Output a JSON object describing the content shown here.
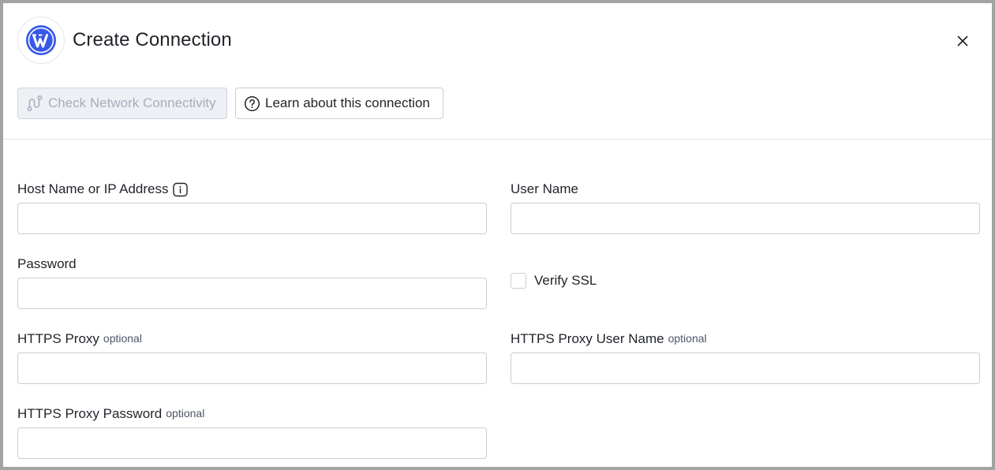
{
  "dialog": {
    "title": "Create Connection",
    "logo_icon": "wordpress-icon",
    "close_icon": "close-icon"
  },
  "toolbar": {
    "check_network_label": "Check Network Connectivity",
    "check_network_icon": "network-route-icon",
    "learn_label": "Learn about this connection",
    "learn_icon": "help-circle-icon"
  },
  "form": {
    "host": {
      "label": "Host Name or IP Address",
      "value": "",
      "info_icon": "info-icon"
    },
    "username": {
      "label": "User Name",
      "value": ""
    },
    "password": {
      "label": "Password",
      "value": ""
    },
    "verify_ssl": {
      "label": "Verify SSL",
      "checked": false
    },
    "https_proxy": {
      "label": "HTTPS Proxy",
      "optional": "optional",
      "value": ""
    },
    "https_proxy_username": {
      "label": "HTTPS Proxy User Name",
      "optional": "optional",
      "value": ""
    },
    "https_proxy_password": {
      "label": "HTTPS Proxy Password",
      "optional": "optional",
      "value": ""
    }
  },
  "colors": {
    "accent": "#3858e9",
    "border": "#c9cdd4",
    "disabled_text": "#a7adba"
  }
}
